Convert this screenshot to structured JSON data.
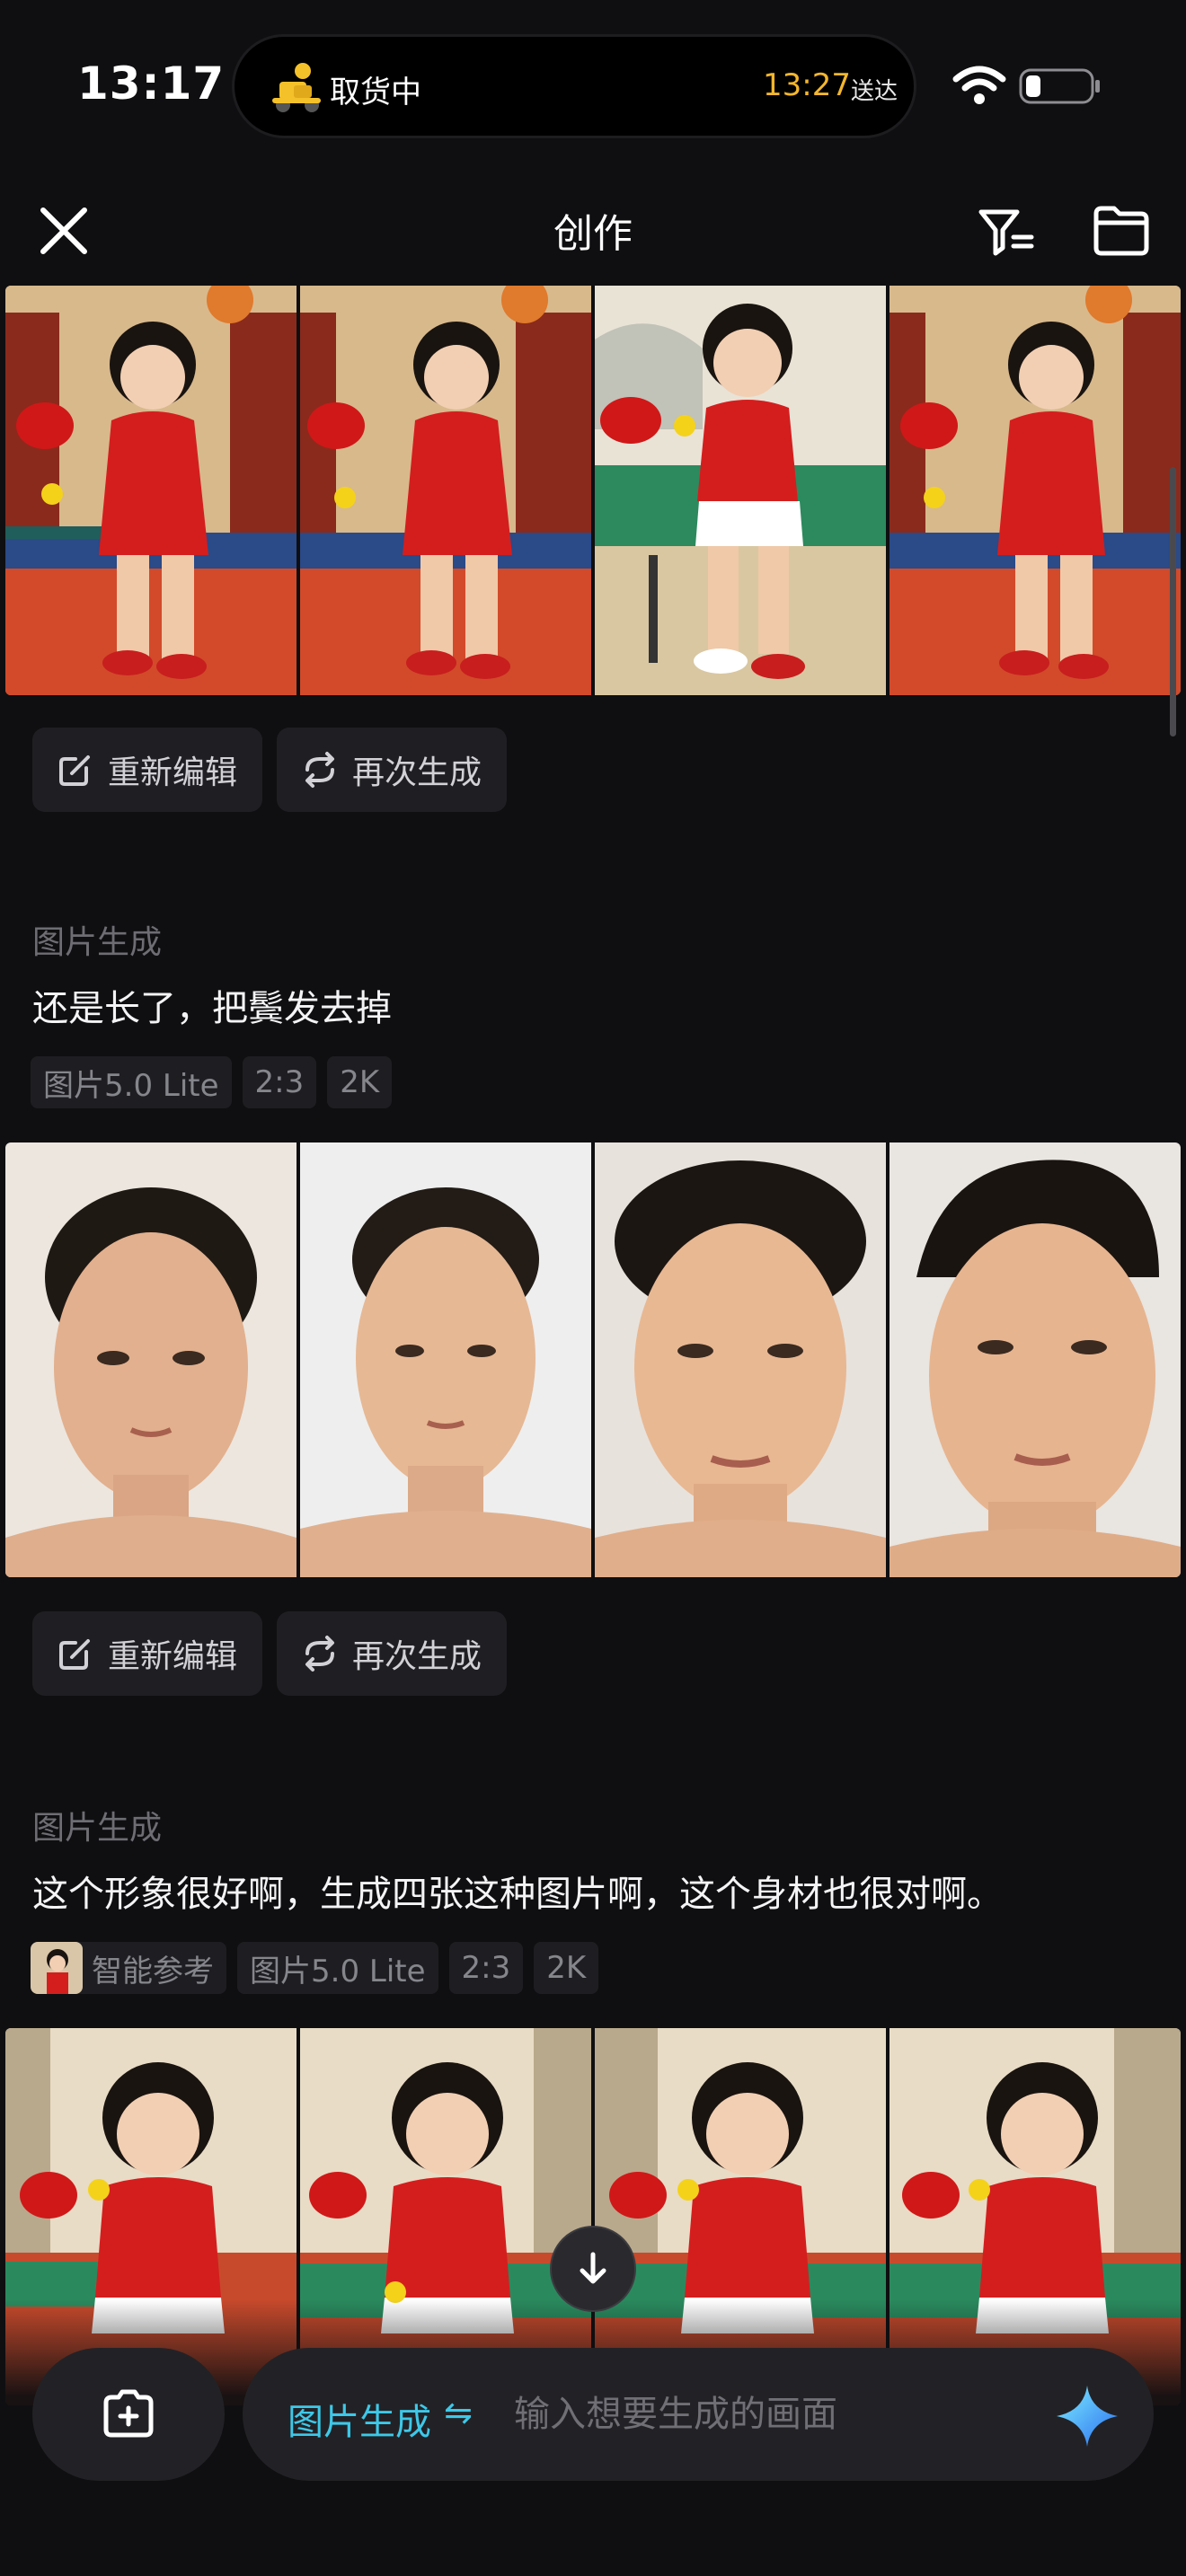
{
  "status_bar": {
    "time": "13:17",
    "live_activity_label": "取货中",
    "live_activity_eta": "13:27",
    "live_activity_eta_suffix": "送达"
  },
  "header": {
    "title": "创作"
  },
  "actions": {
    "re_edit": "重新编辑",
    "regenerate": "再次生成"
  },
  "tasks": [
    {
      "type": "图片生成",
      "prompt": "还是长了，把鬓发去掉",
      "tags": [
        "图片5.0 Lite",
        "2:3",
        "2K"
      ]
    },
    {
      "type": "图片生成",
      "prompt": "这个形象很好啊，生成四张这种图片啊，这个身材也很对啊。",
      "reference_tag": "智能参考",
      "tags": [
        "图片5.0 Lite",
        "2:3",
        "2K"
      ]
    }
  ],
  "composer": {
    "mode_label": "图片生成",
    "mode_swap_glyph": "⇋",
    "placeholder": "输入想要生成的画面"
  },
  "colors": {
    "accent": "#3ec8e8",
    "eta": "#f3b62e",
    "background": "#0f0f11"
  }
}
